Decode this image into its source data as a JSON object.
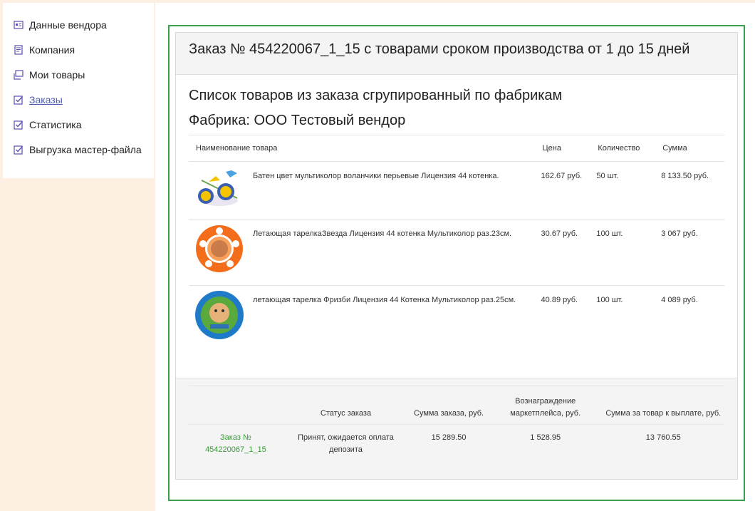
{
  "sidebar": {
    "items": [
      {
        "label": "Данные вендора",
        "icon": "vendor-card-icon"
      },
      {
        "label": "Компания",
        "icon": "document-icon"
      },
      {
        "label": "Мои товары",
        "icon": "products-icon"
      },
      {
        "label": "Заказы",
        "icon": "checkbox-icon"
      },
      {
        "label": "Статистика",
        "icon": "checkbox-icon"
      },
      {
        "label": "Выгрузка мастер-файла",
        "icon": "checkbox-icon"
      }
    ]
  },
  "order": {
    "title": "Заказ № 454220067_1_15 с товарами сроком производства от 1 до 15 дней",
    "subtitle": "Список товаров из заказа сгрупированный по фабрикам",
    "factory": "Фабрика: ООО Тестовый вендор",
    "columns": {
      "name": "Наименование товара",
      "price": "Цена",
      "qty": "Количество",
      "sum": "Сумма"
    },
    "items": [
      {
        "name": "Батен цвет мультиколор воланчики перьевые Лицензия 44 котенка.",
        "price": "162.67 руб.",
        "qty": "50 шт.",
        "sum": "8 133.50 руб.",
        "image": "badminton-set"
      },
      {
        "name": "Летающая тарелкаЗвезда Лицензия 44 котенка Мультиколор раз.23см.",
        "price": "30.67 руб.",
        "qty": "100 шт.",
        "sum": "3 067 руб.",
        "image": "orange-flying-disc"
      },
      {
        "name": "летающая тарелка Фризби Лицензия 44 Котенка Мультиколор раз.25см.",
        "price": "40.89 руб.",
        "qty": "100 шт.",
        "sum": "4 089 руб.",
        "image": "blue-frisbee"
      }
    ]
  },
  "summary": {
    "columns": {
      "order": "",
      "status": "Статус заказа",
      "total": "Сумма заказа, руб.",
      "fee": "Вознаграждение маркетплейса, руб.",
      "payout": "Сумма за товар к выплате, руб."
    },
    "row": {
      "order": "Заказ № 454220067_1_15",
      "status": "Принят, ожидается оплата депозита",
      "total": "15 289.50",
      "fee": "1 528.95",
      "payout": "13 760.55"
    }
  },
  "colors": {
    "accent_green": "#3aa04a",
    "link_orange": "#e8742a",
    "active_blue": "#4a5bb5",
    "page_bg": "#fdf0e3"
  }
}
